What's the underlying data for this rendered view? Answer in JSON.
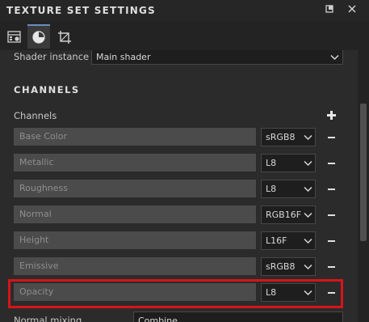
{
  "titlebar": {
    "title": "TEXTURE SET SETTINGS"
  },
  "tabs": [
    {
      "icon": "texture-set-settings-icon",
      "active": false
    },
    {
      "icon": "shader-sphere-icon",
      "active": true
    },
    {
      "icon": "uv-crop-icon",
      "active": false
    }
  ],
  "shader_instance": {
    "label": "Shader instance",
    "value": "Main shader"
  },
  "channels_section": {
    "title": "CHANNELS",
    "label": "Channels",
    "items": [
      {
        "name": "Base Color",
        "format": "sRGB8"
      },
      {
        "name": "Metallic",
        "format": "L8"
      },
      {
        "name": "Roughness",
        "format": "L8"
      },
      {
        "name": "Normal",
        "format": "RGB16F"
      },
      {
        "name": "Height",
        "format": "L16F"
      },
      {
        "name": "Emissive",
        "format": "sRGB8"
      },
      {
        "name": "Opacity",
        "format": "L8"
      }
    ]
  },
  "normal_mixing": {
    "label": "Normal mixing",
    "value": "Combine"
  },
  "colors": {
    "highlight": "#d7141a",
    "accent": "#6a8cc7"
  }
}
